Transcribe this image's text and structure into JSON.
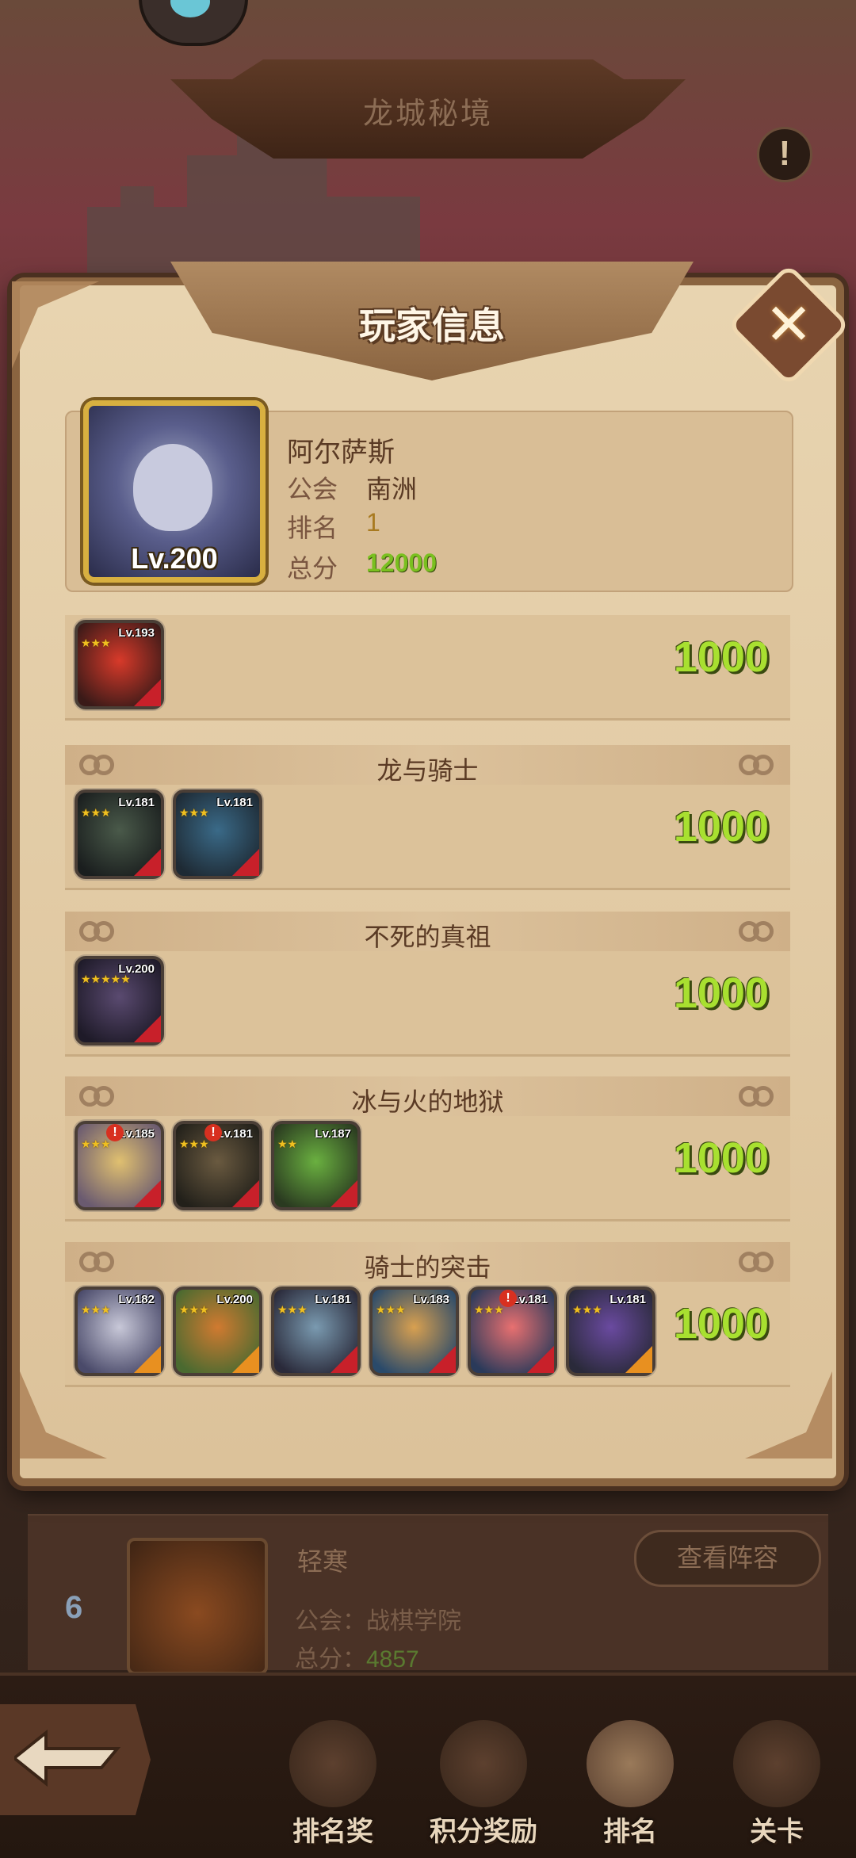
{
  "page": {
    "title": "龙城秘境",
    "info_icon": "exclamation-icon"
  },
  "modal": {
    "title": "玩家信息",
    "close_icon": "close-icon",
    "player": {
      "name": "阿尔萨斯",
      "level": "Lv.200",
      "guild_label": "公会",
      "guild": "南洲",
      "rank_label": "排名",
      "rank": "1",
      "score_label": "总分",
      "score": "12000"
    },
    "teams": [
      {
        "title": "",
        "score": "1000",
        "heroes": [
          {
            "level": "Lv.193",
            "stars": 3,
            "alert": false,
            "colors": [
              "#d83a2a",
              "#3a1a18"
            ],
            "corner": "#c8202a"
          }
        ]
      },
      {
        "title": "龙与骑士",
        "score": "1000",
        "heroes": [
          {
            "level": "Lv.181",
            "stars": 3,
            "alert": false,
            "colors": [
              "#4a5a4a",
              "#1a1e1e"
            ],
            "corner": "#c8202a"
          },
          {
            "level": "Lv.181",
            "stars": 3,
            "alert": false,
            "colors": [
              "#3a6a88",
              "#1e2a34"
            ],
            "corner": "#c8202a"
          }
        ]
      },
      {
        "title": "不死的真祖",
        "score": "1000",
        "heroes": [
          {
            "level": "Lv.200",
            "stars": 5,
            "alert": false,
            "colors": [
              "#5a4a70",
              "#1e1a28"
            ],
            "corner": "#c8202a"
          }
        ]
      },
      {
        "title": "冰与火的地狱",
        "score": "1000",
        "heroes": [
          {
            "level": "Lv.185",
            "stars": 3,
            "alert": true,
            "colors": [
              "#e0c070",
              "#6a5a70"
            ],
            "corner": "#c8202a"
          },
          {
            "level": "Lv.181",
            "stars": 3,
            "alert": true,
            "colors": [
              "#6a5a40",
              "#22201a"
            ],
            "corner": "#c8202a"
          },
          {
            "level": "Lv.187",
            "stars": 2,
            "alert": false,
            "colors": [
              "#6ab040",
              "#2a3a20"
            ],
            "corner": "#c8202a"
          }
        ]
      },
      {
        "title": "骑士的突击",
        "score": "1000",
        "heroes": [
          {
            "level": "Lv.182",
            "stars": 3,
            "alert": false,
            "colors": [
              "#c8c8d8",
              "#4a4a6a"
            ],
            "corner": "#e89020"
          },
          {
            "level": "Lv.200",
            "stars": 3,
            "alert": false,
            "colors": [
              "#d07a30",
              "#4a6a30"
            ],
            "corner": "#e89020"
          },
          {
            "level": "Lv.181",
            "stars": 3,
            "alert": false,
            "colors": [
              "#7a9ab0",
              "#2a2a3a"
            ],
            "corner": "#c8202a"
          },
          {
            "level": "Lv.183",
            "stars": 3,
            "alert": false,
            "colors": [
              "#d8a050",
              "#2a4a6a"
            ],
            "corner": "#c8202a"
          },
          {
            "level": "Lv.181",
            "stars": 3,
            "alert": true,
            "colors": [
              "#e87070",
              "#2a3a5a"
            ],
            "corner": "#c8202a"
          },
          {
            "level": "Lv.181",
            "stars": 3,
            "alert": false,
            "colors": [
              "#6a4aa0",
              "#2a2a3a"
            ],
            "corner": "#e89020"
          }
        ]
      }
    ]
  },
  "background_row": {
    "rank": "6",
    "name": "轻寒",
    "guild": "公会：战棋学院",
    "score_label": "总分：",
    "score": "4857",
    "view_button": "查看阵容"
  },
  "bottom_nav": {
    "back_icon": "back-arrow-icon",
    "items": [
      {
        "label": "排名奖",
        "icon": "rank-reward-icon",
        "active": false
      },
      {
        "label": "积分奖励",
        "icon": "score-reward-icon",
        "active": false
      },
      {
        "label": "排名",
        "icon": "ranking-icon",
        "active": true
      },
      {
        "label": "关卡",
        "icon": "stage-icon",
        "active": false
      }
    ]
  },
  "colors": {
    "score_green": "#a8e030",
    "parchment": "#dcc29a",
    "frame_brown": "#8a6440"
  }
}
